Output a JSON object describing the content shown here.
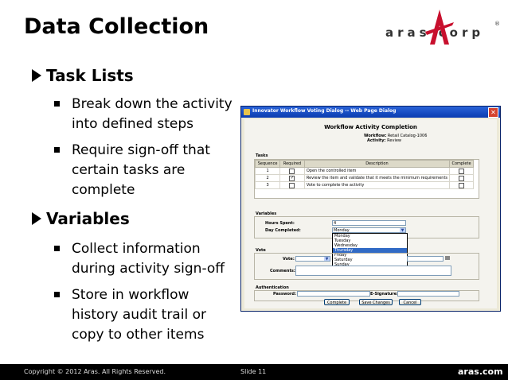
{
  "slide": {
    "title": "Data Collection",
    "logo_text": "aras     corp",
    "logo_reg": "®",
    "bullets": [
      {
        "label": "Task Lists",
        "sub": [
          "Break down the activity into defined steps",
          "Require sign-off that certain tasks are complete"
        ]
      },
      {
        "label": "Variables",
        "sub": [
          "Collect information during activity sign-off",
          "Store in workflow history audit trail or copy to other items"
        ]
      }
    ]
  },
  "footer": {
    "copyright": "Copyright © 2012 Aras.  All Rights Reserved.",
    "slide": "Slide 11",
    "site": "aras.com"
  },
  "colors": {
    "accent_red": "#c8102e",
    "titlebar_blue": "#0a3cb0",
    "footer_bg": "#000000"
  },
  "dialog": {
    "title": "Innovator Workflow Voting Dialog -- Web Page Dialog",
    "heading": "Workflow Activity Completion",
    "workflow_label": "Workflow:",
    "workflow_value": "Retail Catalog-1006",
    "activity_label": "Activity:",
    "activity_value": "Review",
    "tasks": {
      "label": "Tasks",
      "columns": [
        "Sequence",
        "Required",
        "Description",
        "Complete"
      ],
      "rows": [
        {
          "seq": "1",
          "required": false,
          "desc": "Open the controlled item"
        },
        {
          "seq": "2",
          "required": true,
          "desc": "Review the item and validate that it meets the minimum requirements"
        },
        {
          "seq": "3",
          "required": false,
          "desc": "Vote to complete the activity"
        }
      ]
    },
    "variables": {
      "label": "Variables",
      "hours_label": "Hours Spent:",
      "hours_value": "4",
      "day_label": "Day Completed:",
      "day_value": "Monday",
      "day_options": [
        "Monday",
        "Tuesday",
        "Wednesday",
        "Thursday",
        "Friday",
        "Saturday",
        "Sunday"
      ],
      "day_highlighted": "Thursday"
    },
    "vote": {
      "label": "Vote",
      "vote_label": "Vote:",
      "comments_label": "Comments:"
    },
    "auth": {
      "label": "Authentication",
      "password_label": "Password:",
      "esig_label": "E-Signature:"
    },
    "buttons": {
      "complete": "Complete",
      "save": "Save Changes",
      "cancel": "Cancel"
    },
    "close_glyph": "✕"
  }
}
